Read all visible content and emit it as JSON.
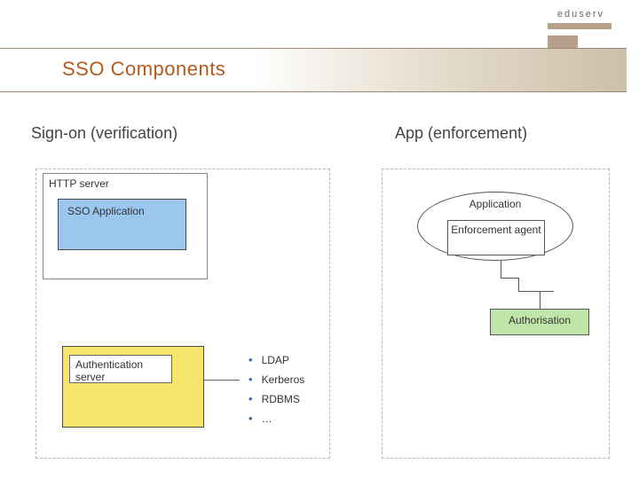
{
  "brand": {
    "name": "eduserv"
  },
  "title": "SSO Components",
  "columns": {
    "left_heading": "Sign-on (verification)",
    "right_heading": "App (enforcement)"
  },
  "left": {
    "http_server_label": "HTTP server",
    "sso_app_label": "SSO Application",
    "auth_server_label": "Authentication server"
  },
  "protocols": {
    "items": [
      "LDAP",
      "Kerberos",
      "RDBMS",
      "…"
    ]
  },
  "right": {
    "application_label": "Application",
    "enforcement_label": "Enforcement agent",
    "authorisation_label": "Authorisation"
  }
}
